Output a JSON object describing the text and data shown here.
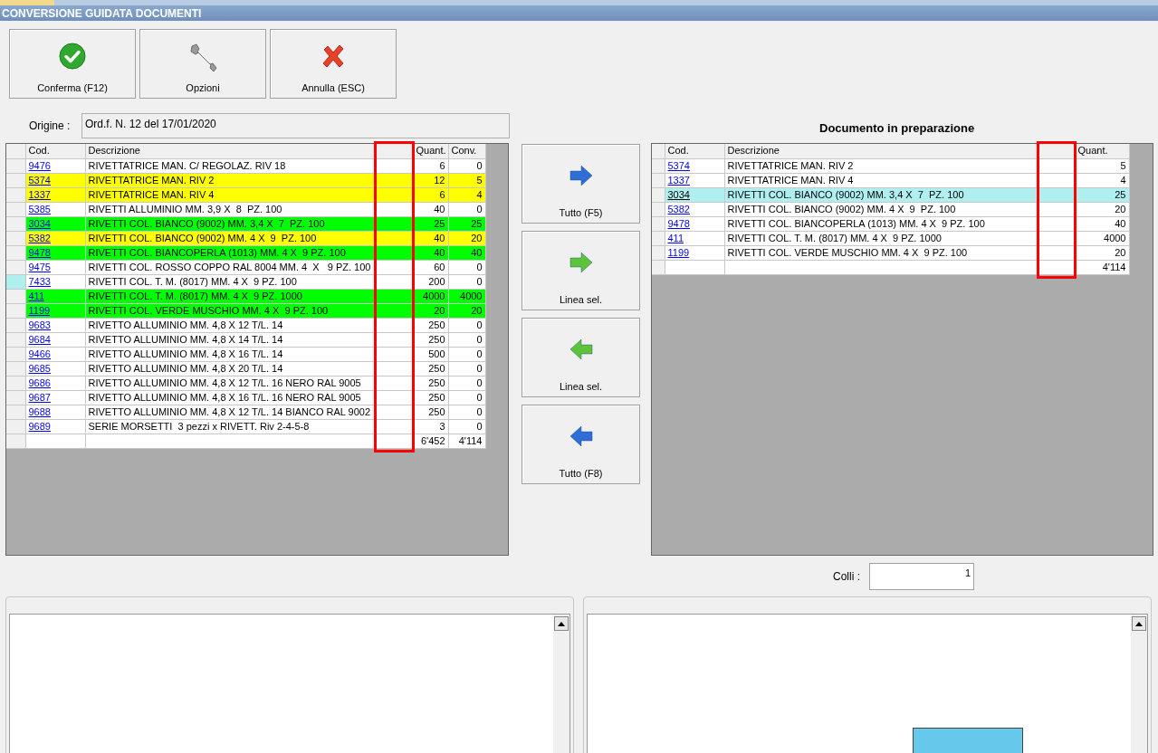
{
  "window": {
    "title": "CONVERSIONE GUIDATA DOCUMENTI"
  },
  "toolbar": [
    {
      "label": "Conferma (F12)",
      "kind": "confirm"
    },
    {
      "label": "Opzioni",
      "kind": "options"
    },
    {
      "label": "Annulla (ESC)",
      "kind": "cancel"
    }
  ],
  "origin": {
    "label": "Origine :",
    "value": "Ord.f. N. 12 del 17/01/2020"
  },
  "source_grid": {
    "column_highlighted": true,
    "columns": [
      "Cod.",
      "Descrizione",
      "",
      "Quant.",
      "Conv."
    ],
    "rows": [
      {
        "code": "9476",
        "description": "RIVETTATRICE MAN. C/ REGOLAZ. RIV 18",
        "quantity": "6",
        "converted": "0",
        "color": "#ffffff",
        "selected": false
      },
      {
        "code": "5374",
        "description": "RIVETTATRICE MAN. RIV 2",
        "quantity": "12",
        "converted": "5",
        "color": "#ffff00",
        "selected": false
      },
      {
        "code": "1337",
        "description": "RIVETTATRICE MAN. RIV 4",
        "quantity": "6",
        "converted": "4",
        "color": "#ffff00",
        "selected": false
      },
      {
        "code": "5385",
        "description": "RIVETTI ALLUMINIO MM. 3,9 X  8  PZ. 100",
        "quantity": "40",
        "converted": "0",
        "color": "#ffffff",
        "selected": false
      },
      {
        "code": "3034",
        "description": "RIVETTI COL. BIANCO (9002) MM. 3,4 X  7  PZ. 100",
        "quantity": "25",
        "converted": "25",
        "color": "#00ff00",
        "selected": false
      },
      {
        "code": "5382",
        "description": "RIVETTI COL. BIANCO (9002) MM. 4 X  9  PZ. 100",
        "quantity": "40",
        "converted": "20",
        "color": "#ffff00",
        "selected": false
      },
      {
        "code": "9478",
        "description": "RIVETTI COL. BIANCOPERLA (1013) MM. 4 X  9 PZ. 100",
        "quantity": "40",
        "converted": "40",
        "color": "#00ff00",
        "selected": false
      },
      {
        "code": "9475",
        "description": "RIVETTI COL. ROSSO COPPO RAL 8004 MM. 4  X   9 PZ. 100",
        "quantity": "60",
        "converted": "0",
        "color": "#ffffff",
        "selected": false
      },
      {
        "code": "7433",
        "description": "RIVETTI COL. T. M. (8017) MM. 4 X  9 PZ. 100",
        "quantity": "200",
        "converted": "0",
        "color": "#ffffff",
        "selected": true
      },
      {
        "code": "411",
        "description": "RIVETTI COL. T. M. (8017) MM. 4 X  9 PZ. 1000",
        "quantity": "4000",
        "converted": "4000",
        "color": "#00ff00",
        "selected": false
      },
      {
        "code": "1199",
        "description": "RIVETTI COL. VERDE MUSCHIO MM. 4 X  9 PZ. 100",
        "quantity": "20",
        "converted": "20",
        "color": "#00ff00",
        "selected": false
      },
      {
        "code": "9683",
        "description": "RIVETTO ALLUMINIO MM. 4,8 X 12 T/L. 14",
        "quantity": "250",
        "converted": "0",
        "color": "#ffffff",
        "selected": false
      },
      {
        "code": "9684",
        "description": "RIVETTO ALLUMINIO MM. 4,8 X 14 T/L. 14",
        "quantity": "250",
        "converted": "0",
        "color": "#ffffff",
        "selected": false
      },
      {
        "code": "9466",
        "description": "RIVETTO ALLUMINIO MM. 4,8 X 16 T/L. 14",
        "quantity": "500",
        "converted": "0",
        "color": "#ffffff",
        "selected": false
      },
      {
        "code": "9685",
        "description": "RIVETTO ALLUMINIO MM. 4,8 X 20 T/L. 14",
        "quantity": "250",
        "converted": "0",
        "color": "#ffffff",
        "selected": false
      },
      {
        "code": "9686",
        "description": "RIVETTO ALLUMINIO MM. 4,8 X 12 T/L. 16 NERO RAL 9005",
        "quantity": "250",
        "converted": "0",
        "color": "#ffffff",
        "selected": false
      },
      {
        "code": "9687",
        "description": "RIVETTO ALLUMINIO MM. 4,8 X 16 T/L. 16 NERO RAL 9005",
        "quantity": "250",
        "converted": "0",
        "color": "#ffffff",
        "selected": false
      },
      {
        "code": "9688",
        "description": "RIVETTO ALLUMINIO MM. 4,8 X 12 T/L. 14 BIANCO RAL 9002",
        "quantity": "250",
        "converted": "0",
        "color": "#ffffff",
        "selected": false
      },
      {
        "code": "9689",
        "description": "SERIE MORSETTI  3 pezzi x RIVETT. Riv 2-4-5-8",
        "quantity": "3",
        "converted": "0",
        "color": "#ffffff",
        "selected": false
      }
    ],
    "totals": {
      "quantity": "6'452",
      "converted": "4'114"
    }
  },
  "transfer_buttons": [
    {
      "label": "Tutto (F5)",
      "kind": "right_all"
    },
    {
      "label": "Linea sel.",
      "kind": "right_one"
    },
    {
      "label": "Linea sel.",
      "kind": "left_one"
    },
    {
      "label": "Tutto (F8)",
      "kind": "left_all"
    }
  ],
  "target_title": "Documento in preparazione",
  "target_grid": {
    "column_highlighted": true,
    "columns": [
      "Cod.",
      "Descrizione",
      "",
      "Quant."
    ],
    "rows": [
      {
        "code": "5374",
        "description": "RIVETTATRICE MAN. RIV 2",
        "quantity": "5",
        "selected": false
      },
      {
        "code": "1337",
        "description": "RIVETTATRICE MAN. RIV 4",
        "quantity": "4",
        "selected": false
      },
      {
        "code": "3034",
        "description": "RIVETTI COL. BIANCO (9002) MM. 3,4 X  7  PZ. 100",
        "quantity": "25",
        "selected": true
      },
      {
        "code": "5382",
        "description": "RIVETTI COL. BIANCO (9002) MM. 4 X  9  PZ. 100",
        "quantity": "20",
        "selected": false
      },
      {
        "code": "9478",
        "description": "RIVETTI COL. BIANCOPERLA (1013) MM. 4 X  9 PZ. 100",
        "quantity": "40",
        "selected": false
      },
      {
        "code": "411",
        "description": "RIVETTI COL. T. M. (8017) MM. 4 X  9 PZ. 1000",
        "quantity": "4000",
        "selected": false
      },
      {
        "code": "1199",
        "description": "RIVETTI COL. VERDE MUSCHIO MM. 4 X  9 PZ. 100",
        "quantity": "20",
        "selected": false
      }
    ],
    "totals": {
      "quantity": "4'114"
    }
  },
  "packages": {
    "label": "Colli :",
    "value": "1"
  }
}
